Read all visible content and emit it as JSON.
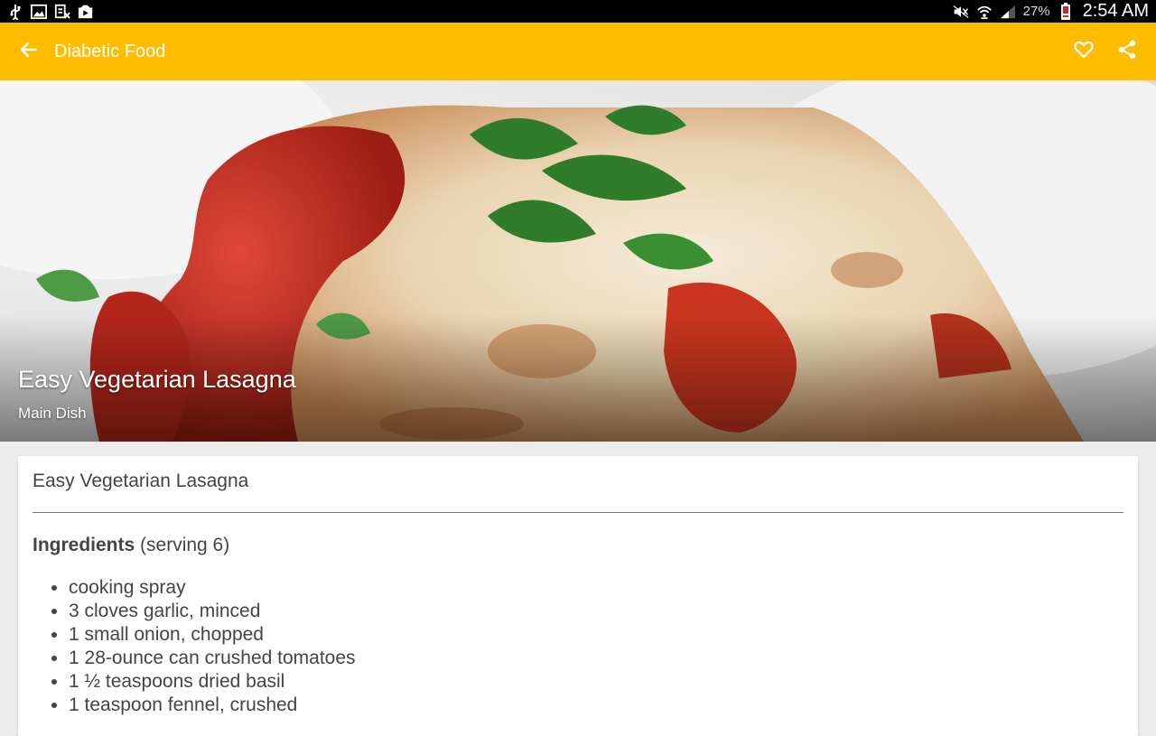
{
  "status_bar": {
    "battery_percent": "27%",
    "time": "2:54 AM"
  },
  "app_bar": {
    "title": "Diabetic Food",
    "color": "#FFBC00"
  },
  "hero": {
    "title": "Easy Vegetarian Lasagna",
    "subtitle": "Main Dish"
  },
  "recipe": {
    "name": "Easy Vegetarian Lasagna",
    "ingredients_label": "Ingredients",
    "serving_text": "(serving 6)",
    "ingredients": [
      "cooking spray",
      "3 cloves garlic, minced",
      "1 small onion, chopped",
      "1 28-ounce can crushed tomatoes",
      "1 ½ teaspoons dried basil",
      "1 teaspoon fennel, crushed"
    ]
  }
}
